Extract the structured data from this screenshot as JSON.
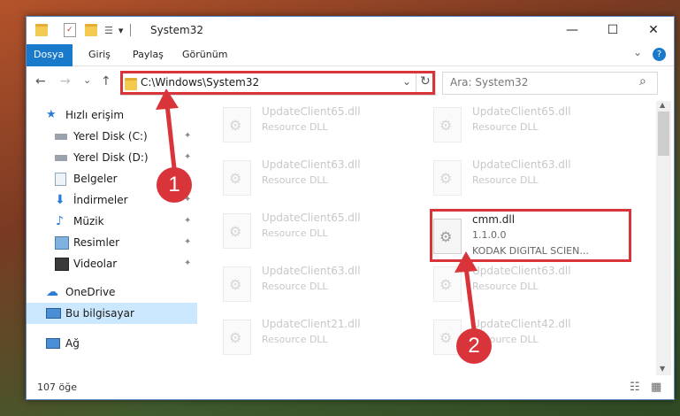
{
  "titlebar": {
    "title": "System32",
    "dropdown_icon": "▾",
    "minimize": "—",
    "maximize": "☐",
    "close": "✕"
  },
  "ribbon": {
    "tabs": [
      "Dosya",
      "Giriş",
      "Paylaş",
      "Görünüm"
    ],
    "expand_icon": "⌄",
    "help_icon": "?"
  },
  "nav": {
    "back": "←",
    "forward": "→",
    "recent": "⌄",
    "up": "↑",
    "address": "C:\\Windows\\System32",
    "address_dropdown": "⌄",
    "refresh": "↻",
    "search_placeholder": "Ara: System32",
    "search_icon": "⌕"
  },
  "navpane": {
    "quick_access": "Hızlı erişim",
    "items": [
      {
        "label": "Yerel Disk (C:)",
        "pinned": true
      },
      {
        "label": "Yerel Disk (D:)",
        "pinned": true
      },
      {
        "label": "Belgeler",
        "pinned": true
      },
      {
        "label": "İndirmeler",
        "pinned": true
      },
      {
        "label": "Müzik",
        "pinned": true
      },
      {
        "label": "Resimler",
        "pinned": true
      },
      {
        "label": "Videolar",
        "pinned": true
      }
    ],
    "onedrive": "OneDrive",
    "this_pc": "Bu bilgisayar",
    "network": "Ağ",
    "pin_icon": "📌"
  },
  "files": [
    {
      "name": "UpdateClient65.dll",
      "desc": "Resource DLL"
    },
    {
      "name": "UpdateClient65.dll",
      "desc": "Resource DLL"
    },
    {
      "name": "UpdateClient63.dll",
      "desc": "Resource DLL"
    },
    {
      "name": "UpdateClient63.dll",
      "desc": "Resource DLL"
    },
    {
      "name": "UpdateClient65.dll",
      "desc": "Resource DLL"
    },
    {
      "name": "cmm.dll",
      "version": "1.1.0.0",
      "desc": "KODAK DIGITAL SCIEN..."
    },
    {
      "name": "UpdateClient63.dll",
      "desc": "Resource DLL"
    },
    {
      "name": "UpdateClient63.dll",
      "desc": "Resource DLL"
    },
    {
      "name": "UpdateClient21.dll",
      "desc": "Resource DLL"
    },
    {
      "name": "UpdateClient42.dll",
      "desc": "Resource DLL"
    }
  ],
  "status": {
    "count": "107 öğe",
    "details_view_icon": "☷",
    "tiles_view_icon": "▦"
  },
  "annotations": {
    "step1": "1",
    "step2": "2",
    "color": "#d9343a"
  }
}
